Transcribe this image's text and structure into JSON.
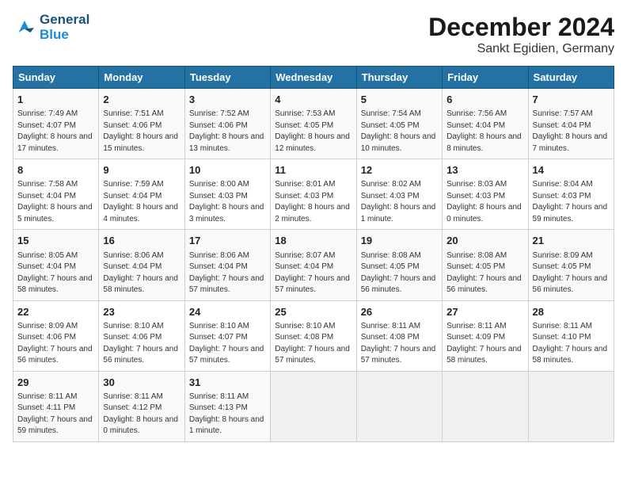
{
  "header": {
    "logo_line1": "General",
    "logo_line2": "Blue",
    "month_year": "December 2024",
    "location": "Sankt Egidien, Germany"
  },
  "weekdays": [
    "Sunday",
    "Monday",
    "Tuesday",
    "Wednesday",
    "Thursday",
    "Friday",
    "Saturday"
  ],
  "weeks": [
    [
      {
        "day": "1",
        "info": "Sunrise: 7:49 AM\nSunset: 4:07 PM\nDaylight: 8 hours and 17 minutes."
      },
      {
        "day": "2",
        "info": "Sunrise: 7:51 AM\nSunset: 4:06 PM\nDaylight: 8 hours and 15 minutes."
      },
      {
        "day": "3",
        "info": "Sunrise: 7:52 AM\nSunset: 4:06 PM\nDaylight: 8 hours and 13 minutes."
      },
      {
        "day": "4",
        "info": "Sunrise: 7:53 AM\nSunset: 4:05 PM\nDaylight: 8 hours and 12 minutes."
      },
      {
        "day": "5",
        "info": "Sunrise: 7:54 AM\nSunset: 4:05 PM\nDaylight: 8 hours and 10 minutes."
      },
      {
        "day": "6",
        "info": "Sunrise: 7:56 AM\nSunset: 4:04 PM\nDaylight: 8 hours and 8 minutes."
      },
      {
        "day": "7",
        "info": "Sunrise: 7:57 AM\nSunset: 4:04 PM\nDaylight: 8 hours and 7 minutes."
      }
    ],
    [
      {
        "day": "8",
        "info": "Sunrise: 7:58 AM\nSunset: 4:04 PM\nDaylight: 8 hours and 5 minutes."
      },
      {
        "day": "9",
        "info": "Sunrise: 7:59 AM\nSunset: 4:04 PM\nDaylight: 8 hours and 4 minutes."
      },
      {
        "day": "10",
        "info": "Sunrise: 8:00 AM\nSunset: 4:03 PM\nDaylight: 8 hours and 3 minutes."
      },
      {
        "day": "11",
        "info": "Sunrise: 8:01 AM\nSunset: 4:03 PM\nDaylight: 8 hours and 2 minutes."
      },
      {
        "day": "12",
        "info": "Sunrise: 8:02 AM\nSunset: 4:03 PM\nDaylight: 8 hours and 1 minute."
      },
      {
        "day": "13",
        "info": "Sunrise: 8:03 AM\nSunset: 4:03 PM\nDaylight: 8 hours and 0 minutes."
      },
      {
        "day": "14",
        "info": "Sunrise: 8:04 AM\nSunset: 4:03 PM\nDaylight: 7 hours and 59 minutes."
      }
    ],
    [
      {
        "day": "15",
        "info": "Sunrise: 8:05 AM\nSunset: 4:04 PM\nDaylight: 7 hours and 58 minutes."
      },
      {
        "day": "16",
        "info": "Sunrise: 8:06 AM\nSunset: 4:04 PM\nDaylight: 7 hours and 58 minutes."
      },
      {
        "day": "17",
        "info": "Sunrise: 8:06 AM\nSunset: 4:04 PM\nDaylight: 7 hours and 57 minutes."
      },
      {
        "day": "18",
        "info": "Sunrise: 8:07 AM\nSunset: 4:04 PM\nDaylight: 7 hours and 57 minutes."
      },
      {
        "day": "19",
        "info": "Sunrise: 8:08 AM\nSunset: 4:05 PM\nDaylight: 7 hours and 56 minutes."
      },
      {
        "day": "20",
        "info": "Sunrise: 8:08 AM\nSunset: 4:05 PM\nDaylight: 7 hours and 56 minutes."
      },
      {
        "day": "21",
        "info": "Sunrise: 8:09 AM\nSunset: 4:05 PM\nDaylight: 7 hours and 56 minutes."
      }
    ],
    [
      {
        "day": "22",
        "info": "Sunrise: 8:09 AM\nSunset: 4:06 PM\nDaylight: 7 hours and 56 minutes."
      },
      {
        "day": "23",
        "info": "Sunrise: 8:10 AM\nSunset: 4:06 PM\nDaylight: 7 hours and 56 minutes."
      },
      {
        "day": "24",
        "info": "Sunrise: 8:10 AM\nSunset: 4:07 PM\nDaylight: 7 hours and 57 minutes."
      },
      {
        "day": "25",
        "info": "Sunrise: 8:10 AM\nSunset: 4:08 PM\nDaylight: 7 hours and 57 minutes."
      },
      {
        "day": "26",
        "info": "Sunrise: 8:11 AM\nSunset: 4:08 PM\nDaylight: 7 hours and 57 minutes."
      },
      {
        "day": "27",
        "info": "Sunrise: 8:11 AM\nSunset: 4:09 PM\nDaylight: 7 hours and 58 minutes."
      },
      {
        "day": "28",
        "info": "Sunrise: 8:11 AM\nSunset: 4:10 PM\nDaylight: 7 hours and 58 minutes."
      }
    ],
    [
      {
        "day": "29",
        "info": "Sunrise: 8:11 AM\nSunset: 4:11 PM\nDaylight: 7 hours and 59 minutes."
      },
      {
        "day": "30",
        "info": "Sunrise: 8:11 AM\nSunset: 4:12 PM\nDaylight: 8 hours and 0 minutes."
      },
      {
        "day": "31",
        "info": "Sunrise: 8:11 AM\nSunset: 4:13 PM\nDaylight: 8 hours and 1 minute."
      },
      {
        "day": "",
        "info": ""
      },
      {
        "day": "",
        "info": ""
      },
      {
        "day": "",
        "info": ""
      },
      {
        "day": "",
        "info": ""
      }
    ]
  ]
}
